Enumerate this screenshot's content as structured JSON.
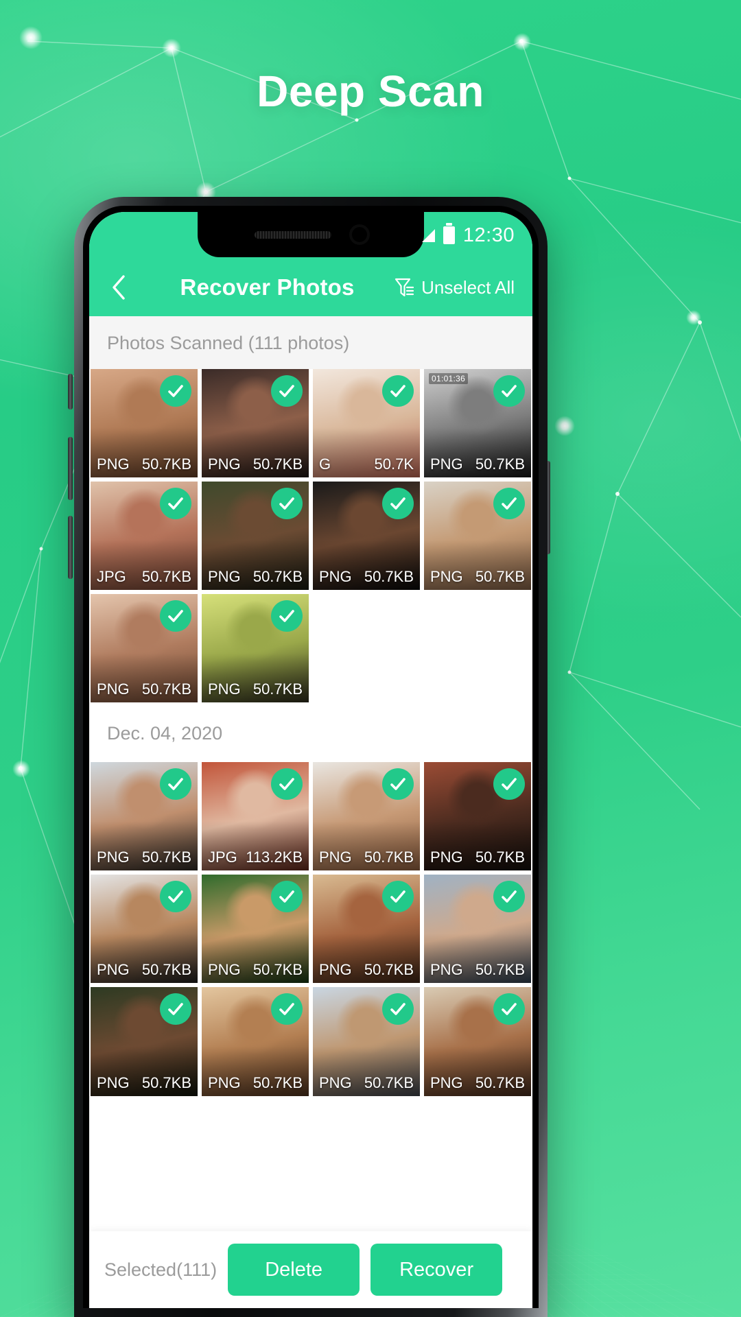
{
  "hero": {
    "headline": "Deep Scan"
  },
  "device": {
    "status_bar": {
      "time": "12:30",
      "signal_icon": "signal-icon",
      "battery_icon": "battery-icon"
    }
  },
  "app": {
    "appbar": {
      "back_icon": "back-chevron-icon",
      "title": "Recover Photos",
      "filter_icon": "filter-funnel-icon",
      "unselect_label": "Unselect All"
    },
    "sections": [
      {
        "title": "Photos Scanned (111 photos)",
        "style": "grey"
      },
      {
        "title": "Dec. 04, 2020",
        "style": "white"
      }
    ],
    "bottom_bar": {
      "selected_label": "Selected(111)",
      "delete_label": "Delete",
      "recover_label": "Recover"
    },
    "photos_group_1": [
      {
        "format": "PNG",
        "size": "50.7KB",
        "selected": true,
        "c1": "#d7a887",
        "c2": "#b07a55",
        "c3": "#5e3a23",
        "badge": ""
      },
      {
        "format": "PNG",
        "size": "50.7KB",
        "selected": true,
        "c1": "#3a2b28",
        "c2": "#8d5f49",
        "c3": "#1d1412",
        "badge": ""
      },
      {
        "format": "G",
        "size": "50.7K",
        "selected": true,
        "c1": "#f2e7dd",
        "c2": "#d9b79a",
        "c3": "#b1604f",
        "badge": ""
      },
      {
        "format": "PNG",
        "size": "50.7KB",
        "selected": true,
        "c1": "#cfcfcf",
        "c2": "#7d7d7d",
        "c3": "#141414",
        "badge": "01:01:36"
      },
      {
        "format": "JPG",
        "size": "50.7KB",
        "selected": true,
        "c1": "#e0c3ab",
        "c2": "#b5735a",
        "c3": "#6c4030",
        "badge": ""
      },
      {
        "format": "PNG",
        "size": "50.7KB",
        "selected": true,
        "c1": "#3f4a2c",
        "c2": "#6b4b33",
        "c3": "#16180f",
        "badge": ""
      },
      {
        "format": "PNG",
        "size": "50.7KB",
        "selected": true,
        "c1": "#1a1a1a",
        "c2": "#6b4731",
        "c3": "#080808",
        "badge": ""
      },
      {
        "format": "PNG",
        "size": "50.7KB",
        "selected": true,
        "c1": "#d9d2c6",
        "c2": "#c49a74",
        "c3": "#7b5b42",
        "badge": ""
      },
      {
        "format": "PNG",
        "size": "50.7KB",
        "selected": true,
        "c1": "#e4c5ad",
        "c2": "#b07c5f",
        "c3": "#6b4530",
        "badge": ""
      },
      {
        "format": "PNG",
        "size": "50.7KB",
        "selected": true,
        "c1": "#d6e07a",
        "c2": "#9aa84a",
        "c3": "#2c2a1b",
        "badge": ""
      }
    ],
    "photos_group_2": [
      {
        "format": "PNG",
        "size": "50.7KB",
        "selected": true,
        "c1": "#cfd8de",
        "c2": "#c08f6e",
        "c3": "#2a2622",
        "badge": ""
      },
      {
        "format": "JPG",
        "size": "113.2KB",
        "selected": true,
        "c1": "#c2553a",
        "c2": "#e0b9a1",
        "c3": "#5a2418",
        "badge": ""
      },
      {
        "format": "PNG",
        "size": "50.7KB",
        "selected": true,
        "c1": "#e9e6e1",
        "c2": "#c79a76",
        "c3": "#8a5c3d",
        "badge": ""
      },
      {
        "format": "PNG",
        "size": "50.7KB",
        "selected": true,
        "c1": "#9b4c35",
        "c2": "#4b2b1f",
        "c3": "#120d0a",
        "badge": ""
      },
      {
        "format": "PNG",
        "size": "50.7KB",
        "selected": true,
        "c1": "#e4e4e4",
        "c2": "#b7875f",
        "c3": "#1c1c1c",
        "badge": ""
      },
      {
        "format": "PNG",
        "size": "50.7KB",
        "selected": true,
        "c1": "#2f6b2c",
        "c2": "#c99a68",
        "c3": "#123310",
        "badge": ""
      },
      {
        "format": "PNG",
        "size": "50.7KB",
        "selected": true,
        "c1": "#d9bb92",
        "c2": "#a5643f",
        "c3": "#3c2415",
        "badge": ""
      },
      {
        "format": "PNG",
        "size": "50.7KB",
        "selected": true,
        "c1": "#9fb2c4",
        "c2": "#cfa98c",
        "c3": "#2c3c4c",
        "badge": ""
      },
      {
        "format": "PNG",
        "size": "50.7KB",
        "selected": true,
        "c1": "#2d3a22",
        "c2": "#6d4a32",
        "c3": "#0e1209",
        "badge": ""
      },
      {
        "format": "PNG",
        "size": "50.7KB",
        "selected": true,
        "c1": "#e3c69f",
        "c2": "#b37f52",
        "c3": "#4a2f1c",
        "badge": ""
      },
      {
        "format": "PNG",
        "size": "50.7KB",
        "selected": true,
        "c1": "#c9d6e2",
        "c2": "#bf9872",
        "c3": "#3a3f46",
        "badge": ""
      },
      {
        "format": "PNG",
        "size": "50.7KB",
        "selected": true,
        "c1": "#d9cbb4",
        "c2": "#a8714a",
        "c3": "#40281a",
        "badge": ""
      }
    ],
    "colors": {
      "brand_green": "#2ED99A",
      "button_green": "#22D28F",
      "check_green": "#22C98A",
      "section_grey_bg": "#F5F5F5",
      "muted_text": "#9b9b9b"
    }
  }
}
